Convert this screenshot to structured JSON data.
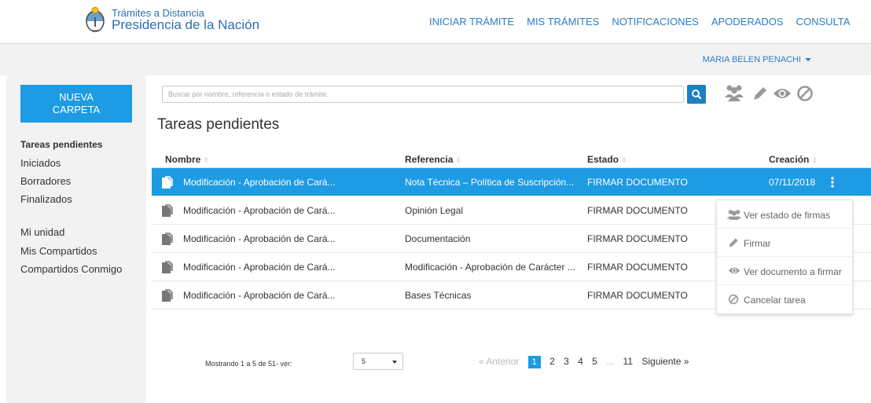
{
  "header": {
    "brand_line1": "Trámites a Distancia",
    "brand_line2": "Presidencia de la Nación",
    "nav": [
      "INICIAR TRÁMITE",
      "MIS TRÁMITES",
      "NOTIFICACIONES",
      "APODERADOS",
      "CONSULTA"
    ]
  },
  "user": {
    "name": "MARIA BELEN PENACHI"
  },
  "sidebar": {
    "new_folder_line1": "NUEVA",
    "new_folder_line2": "CARPETA",
    "items": [
      "Tareas pendientes",
      "Iniciados",
      "Borradores",
      "Finalizados",
      "Mi unidad",
      "Mis Compartidos",
      "Compartidos Conmigo"
    ],
    "active": "Tareas pendientes"
  },
  "search": {
    "placeholder": "Buscar por nombre, referencia o estado de trámite."
  },
  "toolbar_icons": [
    "group-icon",
    "pencil-icon",
    "eye-icon",
    "cancel-icon"
  ],
  "page_title": "Tareas pendientes",
  "table": {
    "columns": [
      "Nombre",
      "Referencia",
      "Estado",
      "Creación"
    ],
    "rows": [
      {
        "nombre": "Modificación - Aprobación de Cará...",
        "referencia": "Nota Técnica – Política de Suscripción...",
        "estado": "FIRMAR DOCUMENTO",
        "creacion": "07/11/2018"
      },
      {
        "nombre": "Modificación - Aprobación de Cará...",
        "referencia": "Opinión Legal",
        "estado": "FIRMAR DOCUMENTO",
        "creacion": ""
      },
      {
        "nombre": "Modificación - Aprobación de Cará...",
        "referencia": "Documentación",
        "estado": "FIRMAR DOCUMENTO",
        "creacion": ""
      },
      {
        "nombre": "Modificación - Aprobación de Cará...",
        "referencia": "Modificación - Aprobación de Carácter ...",
        "estado": "FIRMAR DOCUMENTO",
        "creacion": ""
      },
      {
        "nombre": "Modificación - Aprobación de Cará...",
        "referencia": "Bases Técnicas",
        "estado": "FIRMAR DOCUMENTO",
        "creacion": ""
      }
    ]
  },
  "context_menu": {
    "items": [
      {
        "label": "Ver estado de firmas",
        "icon": "group-icon"
      },
      {
        "label": "Firmar",
        "icon": "pencil-icon"
      },
      {
        "label": "Ver documento a firmar",
        "icon": "eye-icon"
      },
      {
        "label": "Cancelar tarea",
        "icon": "cancel-icon"
      }
    ]
  },
  "pager": {
    "info": "Mostrando 1 a 5 de 51- ver:",
    "page_size": "5",
    "prev": "« Anterior",
    "pages": [
      "1",
      "2",
      "3",
      "4",
      "5",
      "...",
      "11"
    ],
    "current": "1",
    "next": "Siguiente »"
  },
  "colors": {
    "primary": "#1d9be3",
    "link": "#2b7ec4",
    "sidebar_bg": "#f2f2f2"
  }
}
